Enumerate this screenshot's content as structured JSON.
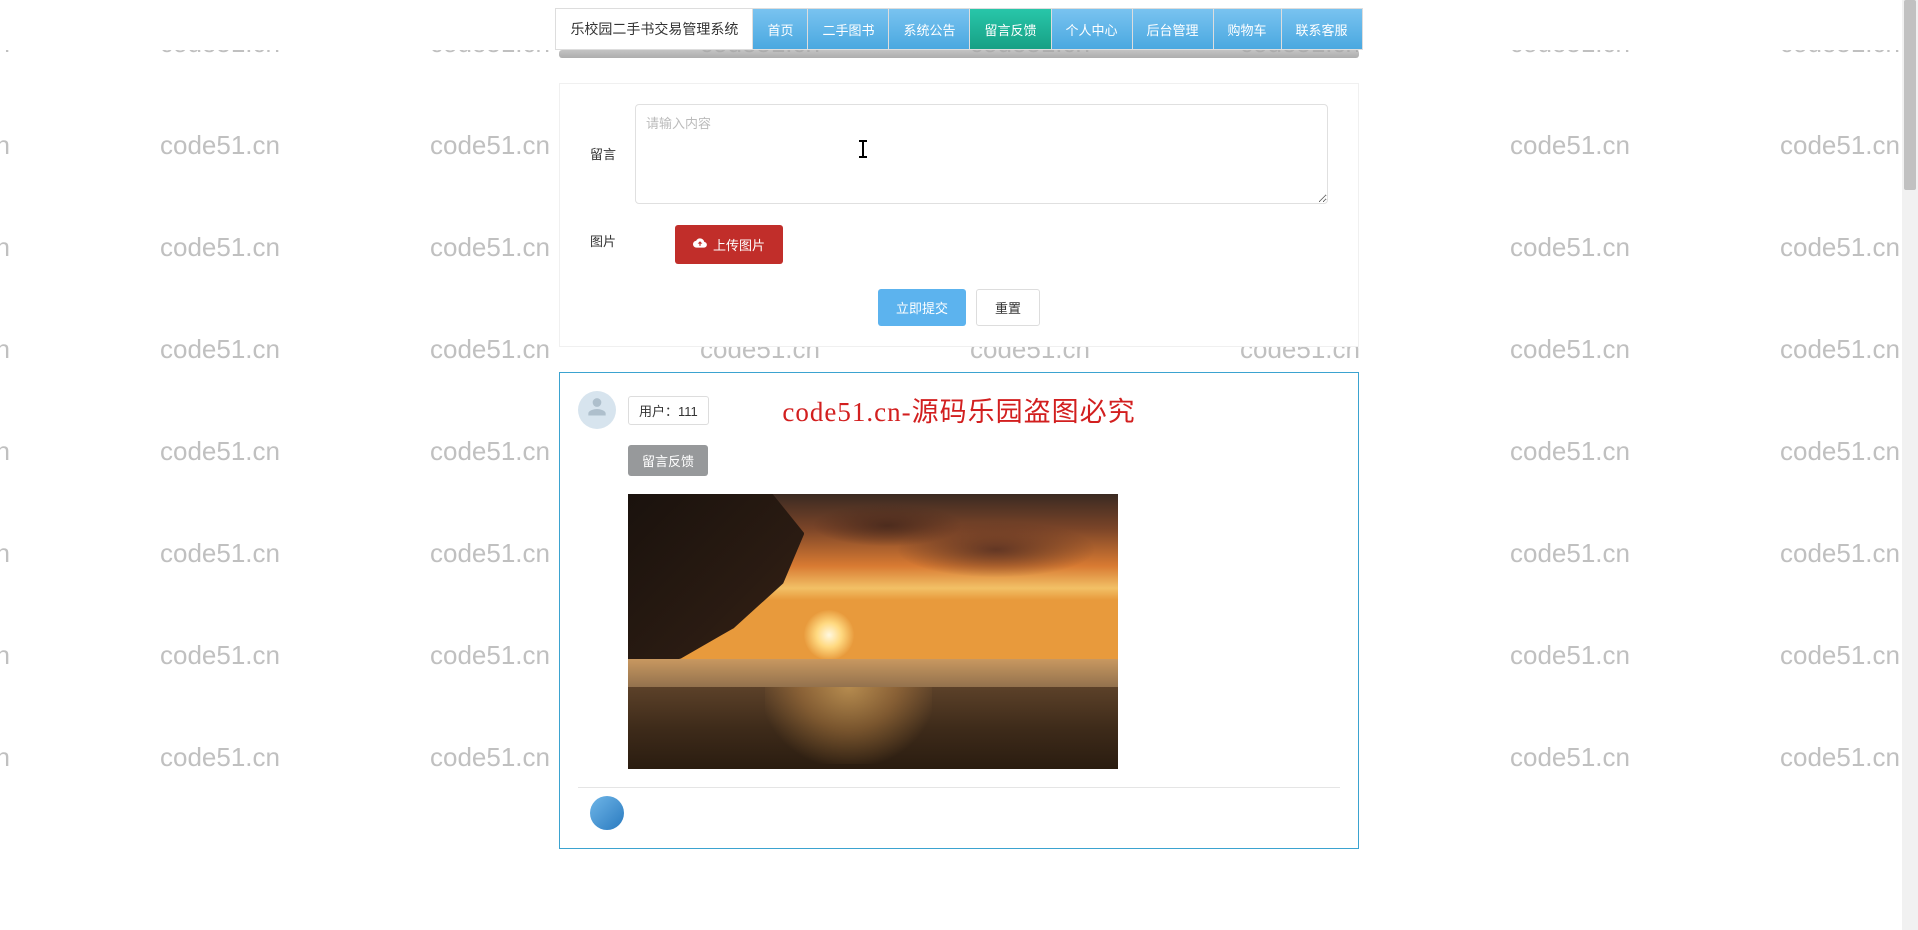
{
  "watermark_text": "code51.cn",
  "overlay_watermark": "code51.cn-源码乐园盗图必究",
  "topbar": {
    "title": "乐校园二手书交易管理系统",
    "nav": [
      {
        "label": "首页",
        "active": false
      },
      {
        "label": "二手图书",
        "active": false
      },
      {
        "label": "系统公告",
        "active": false
      },
      {
        "label": "留言反馈",
        "active": true
      },
      {
        "label": "个人中心",
        "active": false
      },
      {
        "label": "后台管理",
        "active": false
      },
      {
        "label": "购物车",
        "active": false
      },
      {
        "label": "联系客服",
        "active": false
      }
    ]
  },
  "form": {
    "message_label": "留言",
    "message_placeholder": "请输入内容",
    "message_value": "",
    "image_label": "图片",
    "upload_button": "上传图片",
    "submit_button": "立即提交",
    "reset_button": "重置"
  },
  "post": {
    "user_label": "用户：111",
    "feedback_button": "留言反馈"
  }
}
